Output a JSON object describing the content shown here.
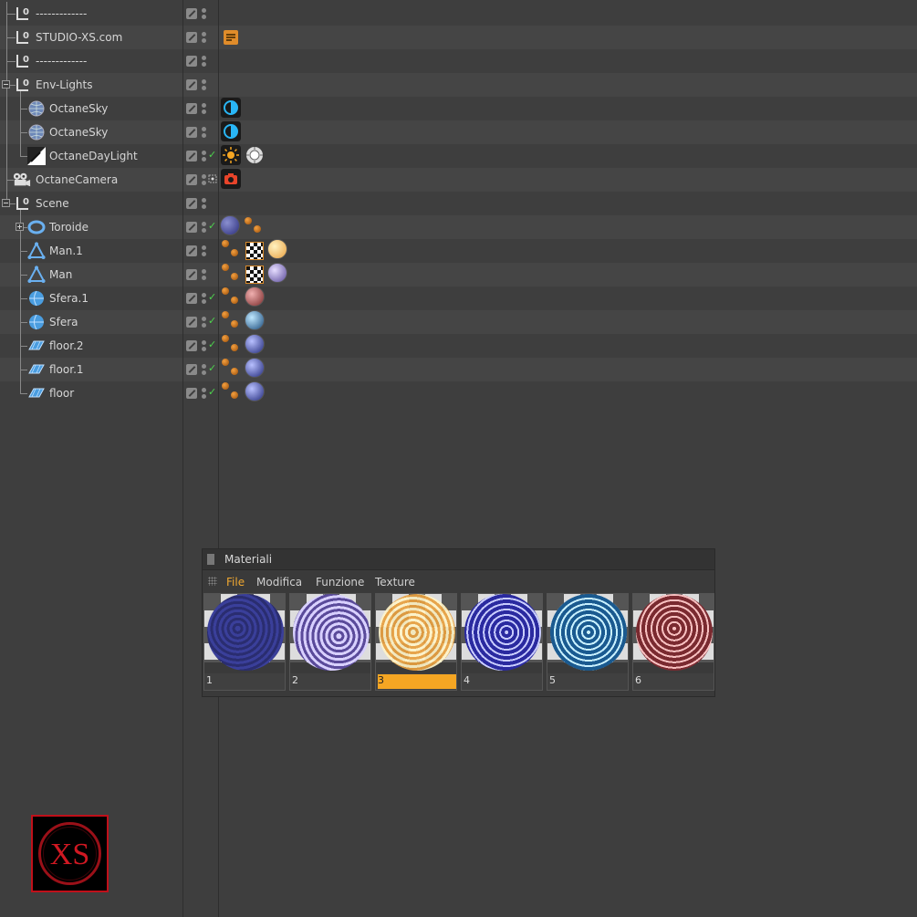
{
  "objects": [
    {
      "name": "-------------",
      "icon": "null-icon",
      "depth": 0
    },
    {
      "name": "STUDIO-XS.com",
      "icon": "null-icon",
      "depth": 0
    },
    {
      "name": "-------------",
      "icon": "null-icon",
      "depth": 0
    },
    {
      "name": "Env-Lights",
      "icon": "null-icon",
      "depth": 0,
      "expanded": true
    },
    {
      "name": "OctaneSky",
      "icon": "sky-icon",
      "depth": 1
    },
    {
      "name": "OctaneSky",
      "icon": "sky-icon",
      "depth": 1
    },
    {
      "name": "OctaneDayLight",
      "icon": "daylight-icon",
      "depth": 1
    },
    {
      "name": "OctaneCamera",
      "icon": "camera-icon",
      "depth": 0
    },
    {
      "name": "Scene",
      "icon": "null-icon",
      "depth": 0,
      "expanded": true
    },
    {
      "name": "Toroide",
      "icon": "torus-icon",
      "depth": 1,
      "collapsed": true
    },
    {
      "name": "Man.1",
      "icon": "polygon-icon",
      "depth": 1
    },
    {
      "name": "Man",
      "icon": "polygon-icon",
      "depth": 1
    },
    {
      "name": "Sfera.1",
      "icon": "sphere-icon",
      "depth": 1
    },
    {
      "name": "Sfera",
      "icon": "sphere-icon",
      "depth": 1
    },
    {
      "name": "floor.2",
      "icon": "plane-icon",
      "depth": 1
    },
    {
      "name": "floor.1",
      "icon": "plane-icon",
      "depth": 1
    },
    {
      "name": "floor",
      "icon": "plane-icon",
      "depth": 1
    }
  ],
  "materials_panel": {
    "title": "Materiali",
    "menu": [
      "File",
      "Modifica",
      "Funzione",
      "Texture"
    ],
    "active_menu": "File",
    "materials": [
      "1",
      "2",
      "3",
      "4",
      "5",
      "6"
    ],
    "selected": "3"
  },
  "logo": {
    "text": "XS",
    "color": "#c0101a"
  },
  "colors": {
    "accent": "#f5a623",
    "check": "#4ed44e",
    "background": "#3e3e3e"
  }
}
